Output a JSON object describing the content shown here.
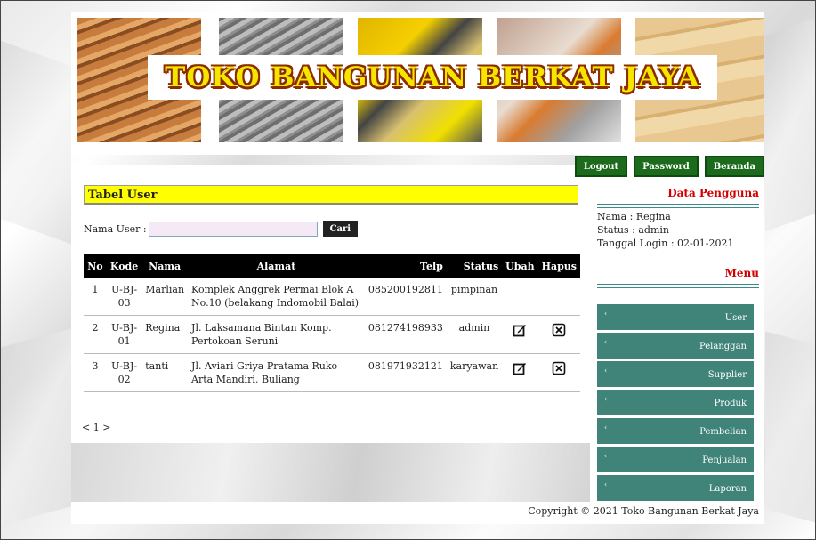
{
  "banner": {
    "title": "TOKO BANGUNAN BERKAT JAYA"
  },
  "nav": {
    "logout": "Logout",
    "password": "Password",
    "beranda": "Beranda"
  },
  "main": {
    "section_title": "Tabel User",
    "search_label": "Nama User :",
    "search_value": "",
    "search_button": "Cari",
    "columns": [
      "No",
      "Kode",
      "Nama",
      "Alamat",
      "Telp",
      "Status",
      "Ubah",
      "Hapus"
    ],
    "rows": [
      {
        "no": "1",
        "kode": "U-BJ-03",
        "nama": "Marlian",
        "alamat": "Komplek Anggrek Permai Blok A No.10 (belakang Indomobil Balai)",
        "telp": "085200192811",
        "status": "pimpinan"
      },
      {
        "no": "2",
        "kode": "U-BJ-01",
        "nama": "Regina",
        "alamat": "Jl. Laksamana Bintan Komp. Pertokoan Seruni",
        "telp": "081274198933",
        "status": "admin"
      },
      {
        "no": "3",
        "kode": "U-BJ-02",
        "nama": "tanti",
        "alamat": "Jl. Aviari Griya Pratama Ruko Arta Mandiri, Buliang",
        "telp": "081971932121",
        "status": "karyawan"
      }
    ],
    "pager": "< 1 >"
  },
  "sidebar": {
    "user_title": "Data Pengguna",
    "nama": "Nama : Regina",
    "status": "Status : admin",
    "login": "Tanggal Login : 02-01-2021",
    "menu_title": "Menu",
    "menu": [
      "User",
      "Pelanggan",
      "Supplier",
      "Produk",
      "Pembelian",
      "Penjualan",
      "Laporan"
    ]
  },
  "footer": {
    "copyright": "Copyright © 2021 Toko Bangunan Berkat Jaya"
  },
  "colors": {
    "accent_green": "#1c6b1c",
    "menu_teal": "#3f8379",
    "title_yellow": "#ffff00",
    "red_heading": "#d40000"
  }
}
